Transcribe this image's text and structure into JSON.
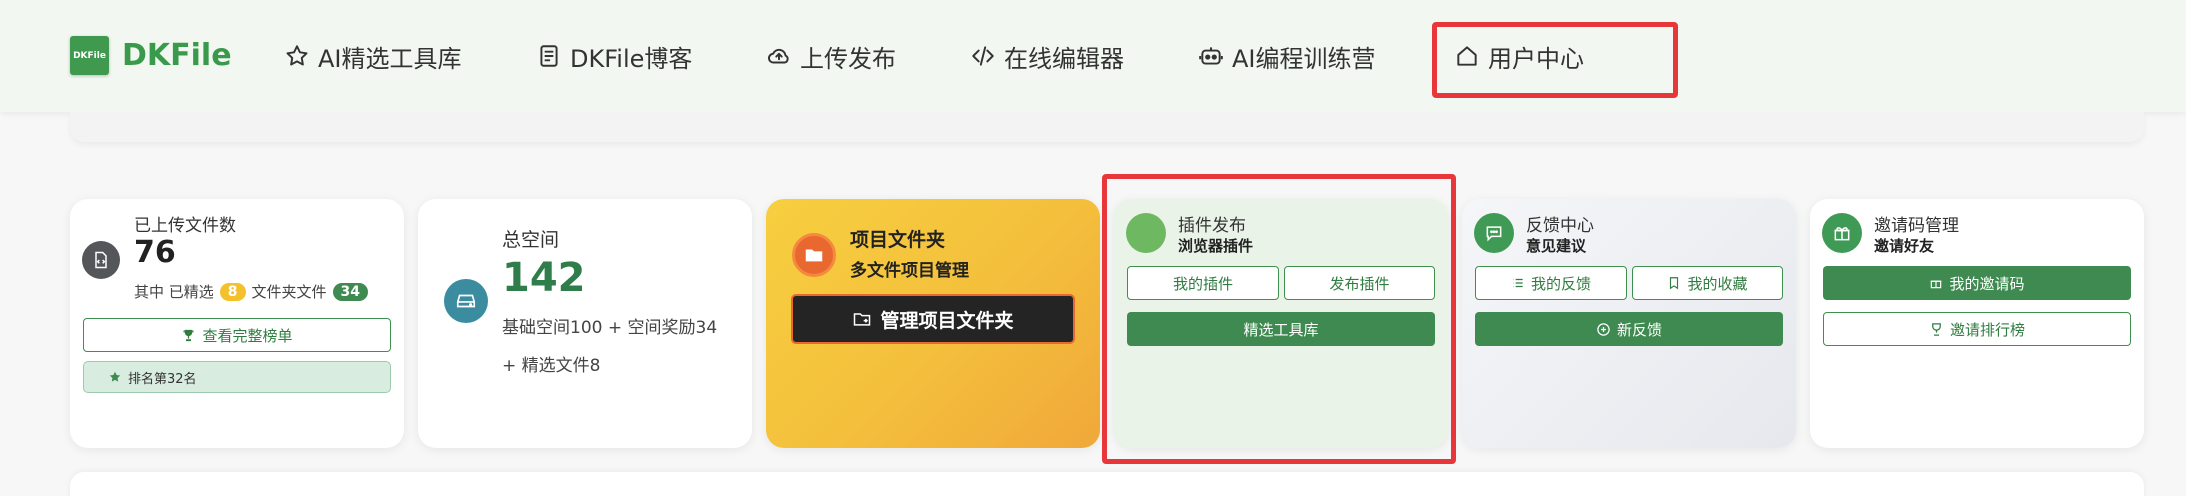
{
  "brand": {
    "logo_text": "DKFile",
    "name": "DKFile"
  },
  "nav": {
    "items": [
      {
        "label": "AI精选工具库",
        "icon": "star-icon"
      },
      {
        "label": "DKFile博客",
        "icon": "document-icon"
      },
      {
        "label": "上传发布",
        "icon": "cloud-upload-icon"
      },
      {
        "label": "在线编辑器",
        "icon": "code-icon"
      },
      {
        "label": "AI编程训练营",
        "icon": "robot-icon"
      },
      {
        "label": "用户中心",
        "icon": "home-icon"
      }
    ]
  },
  "cards": {
    "uploads": {
      "title": "已上传文件数",
      "count": "76",
      "detail_prefix": "其中 已精选",
      "selected_count": "8",
      "detail_mid": "文件夹文件",
      "folder_count": "34",
      "leaderboard_button": "查看完整榜单",
      "rank_text": "排名第32名"
    },
    "space": {
      "title": "总空间",
      "value": "142",
      "detail_line1": "基础空间100 + 空间奖励34",
      "detail_line2": "+ 精选文件8"
    },
    "project": {
      "title": "项目文件夹",
      "subtitle": "多文件项目管理",
      "button": "管理项目文件夹"
    },
    "plugins": {
      "title": "插件发布",
      "subtitle": "浏览器插件",
      "my_plugins": "我的插件",
      "publish_plugin": "发布插件",
      "toolbox": "精选工具库"
    },
    "feedback": {
      "title": "反馈中心",
      "subtitle": "意见建议",
      "my_feedback": "我的反馈",
      "my_favorites": "我的收藏",
      "new_feedback": "新反馈"
    },
    "invite": {
      "title": "邀请码管理",
      "subtitle": "邀请好友",
      "my_codes": "我的邀请码",
      "ranking": "邀请排行榜"
    }
  },
  "colors": {
    "brand_green": "#3a9a4c",
    "highlight_red": "#e8373a",
    "badge_yellow": "#f4c02c",
    "badge_green": "#3f8a50",
    "project_gradient_start": "#f7cf3f",
    "project_gradient_end": "#f0a83a"
  }
}
